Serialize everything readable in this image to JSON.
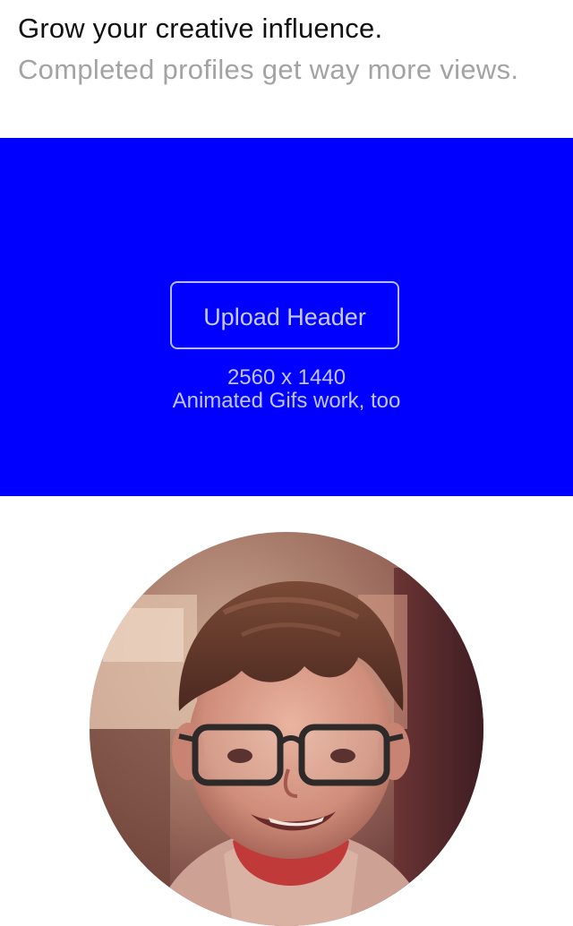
{
  "intro": {
    "title": "Grow your creative influence.",
    "subtitle": "Completed profiles get way more views."
  },
  "header_upload": {
    "background_color": "#0000ff",
    "button_label": "Upload Header",
    "dimensions": "2560 x 1440",
    "hint": "Animated Gifs work, too"
  },
  "avatar": {
    "icon": "profile-photo"
  }
}
